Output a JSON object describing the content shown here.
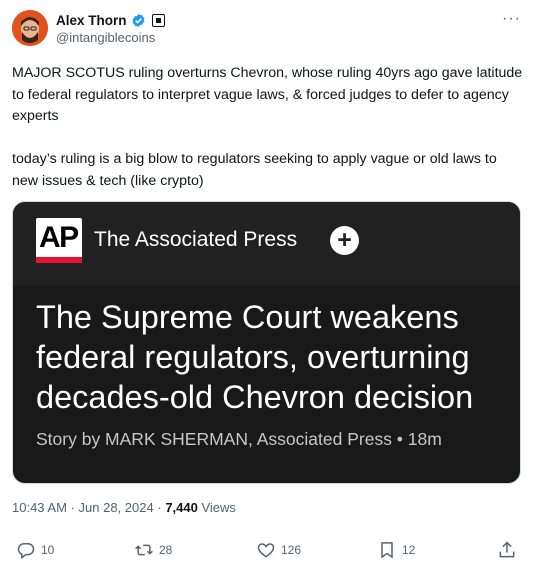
{
  "author": {
    "display_name": "Alex Thorn",
    "handle": "@intangiblecoins",
    "avatar_icon": "avatar-photo"
  },
  "menu": {
    "more_label": "···"
  },
  "tweet": {
    "paragraphs": [
      "MAJOR SCOTUS ruling overturns Chevron, whose ruling 40yrs ago gave latitude to federal regulators to interpret vague laws, & forced judges to defer to agency experts",
      "today’s ruling is a big blow to regulators seeking to apply vague or old laws to new issues & tech (like crypto)"
    ]
  },
  "card": {
    "logo_text": "AP",
    "publisher": "The Associated Press",
    "follow_label": "+",
    "headline": "The Supreme Court weakens federal regulators, overturning decades-old Chevron decision",
    "byline": "Story by MARK SHERMAN, Associated Press • 18m"
  },
  "meta": {
    "time": "10:43 AM",
    "date": "Jun 28, 2024",
    "separator": "·",
    "views_count": "7,440",
    "views_label": "Views"
  },
  "actions": {
    "replies": "10",
    "reposts": "28",
    "likes": "126",
    "bookmarks": "12"
  },
  "colors": {
    "verified": "#1d9bf0",
    "secondary_text": "#536471",
    "card_bg": "#191919",
    "ap_red": "#e7132e"
  }
}
